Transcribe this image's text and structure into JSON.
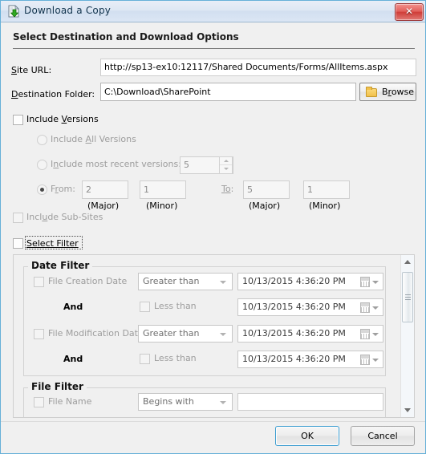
{
  "window": {
    "title": "Download a Copy",
    "icon": "download-document-icon",
    "close_label": "✕"
  },
  "headline": "Select Destination and Download Options",
  "destination": {
    "site_url_label": "Site URL:",
    "site_url_accel": "S",
    "site_url_value": "http://sp13-ex10:12117/Shared Documents/Forms/AllItems.aspx",
    "folder_label": "Destination Folder:",
    "folder_accel": "D",
    "folder_value": "C:\\Download\\SharePoint",
    "browse_label_pre": "B",
    "browse_label_accel": "r",
    "browse_label_post": "owse",
    "browse_icon": "folder-icon"
  },
  "versions": {
    "include_versions_label": "Include ",
    "include_versions_accel": "V",
    "include_versions_post": "ersions",
    "include_versions_checked": false,
    "all_versions_label_pre": "Include ",
    "all_versions_accel": "A",
    "all_versions_post": "ll Versions",
    "all_versions_selected": false,
    "recent_label_pre": "I",
    "recent_accel": "n",
    "recent_post": "clude most recent versions:",
    "recent_selected": false,
    "recent_count": "5",
    "from_label_pre": "F",
    "from_accel": "r",
    "from_post": "om:",
    "from_selected": true,
    "from_major": "2",
    "from_minor": "1",
    "to_label_pre": "T",
    "to_accel": "o",
    "to_post": ":",
    "to_major": "5",
    "to_minor": "1",
    "major_caption": "(Major)",
    "minor_caption": "(Minor)",
    "subsites_label_pre": "Incl",
    "subsites_accel": "u",
    "subsites_post": "de Sub-Sites",
    "subsites_checked": false
  },
  "select_filter": {
    "label": "Select Filter",
    "checked": false,
    "focused": true
  },
  "date_filter": {
    "group_title": "Date Filter",
    "rows": [
      {
        "checkbox_label": "File Creation Date",
        "checked": false,
        "operator": "Greater than",
        "date_value": "10/13/2015  4:36:20 PM"
      },
      {
        "conjunction": "And",
        "checkbox_label": "Less than",
        "checked": false,
        "date_value": "10/13/2015  4:36:20 PM"
      },
      {
        "checkbox_label": "File Modification Date",
        "checked": false,
        "operator": "Greater than",
        "date_value": "10/13/2015  4:36:20 PM"
      },
      {
        "conjunction": "And",
        "checkbox_label": "Less than",
        "checked": false,
        "date_value": "10/13/2015  4:36:20 PM"
      }
    ]
  },
  "file_filter": {
    "group_title": "File Filter",
    "rows": [
      {
        "checkbox_label": "File Name",
        "checked": false,
        "operator": "Begins with",
        "text_value": ""
      }
    ]
  },
  "scrollbar": {
    "up_icon": "scroll-up-arrow-icon",
    "down_icon": "scroll-down-arrow-icon",
    "thumb": "scroll-thumb"
  },
  "footer": {
    "ok_label": "OK",
    "cancel_label": "Cancel"
  },
  "colors": {
    "window_border": "#66b0d8",
    "titlebar": "#dde7f3",
    "close_red": "#cf3d38",
    "default_button_border": "#3c9dd0",
    "body": "#f0f0f0"
  }
}
